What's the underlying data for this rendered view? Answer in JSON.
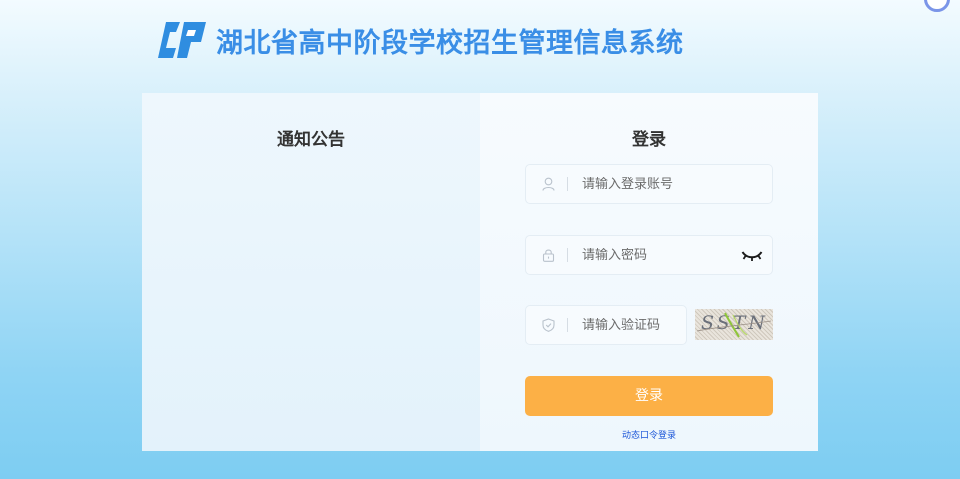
{
  "header": {
    "title": "湖北省高中阶段学校招生管理信息系统",
    "logo_icon": "cp-logo-icon",
    "brand_color": "#3a8ee6"
  },
  "notice": {
    "title": "通知公告"
  },
  "login": {
    "title": "登录",
    "account": {
      "placeholder": "请输入登录账号",
      "value": "",
      "icon": "user-icon"
    },
    "password": {
      "placeholder": "请输入密码",
      "value": "",
      "icon": "lock-icon",
      "toggle_icon": "eye-closed-icon"
    },
    "captcha": {
      "placeholder": "请输入验证码",
      "value": "",
      "icon": "shield-icon",
      "image_text": "SSTN"
    },
    "submit_label": "登录",
    "submit_color": "#fcb046",
    "otp_link": "动态口令登录",
    "link_color": "#1a55d8"
  }
}
